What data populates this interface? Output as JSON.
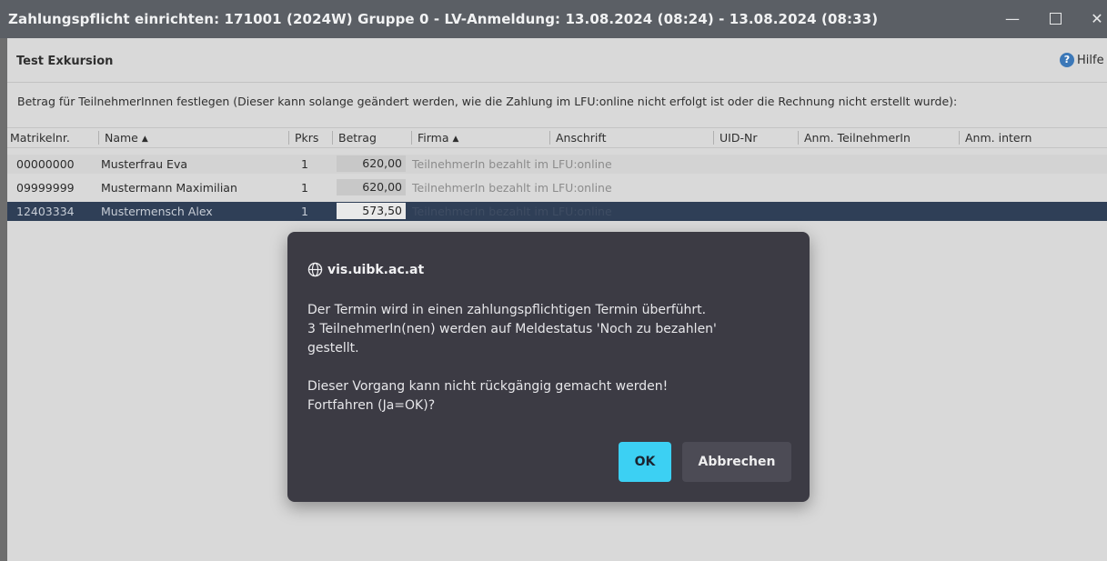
{
  "window": {
    "title": "Zahlungspflicht einrichten:  171001 (2024W)  Gruppe 0 - LV-Anmeldung: 13.08.2024 (08:24) - 13.08.2024 (08:33)",
    "minimize": "—",
    "close": "✕"
  },
  "header": {
    "name": "Test Exkursion",
    "help": "Hilfe",
    "help_icon": "?"
  },
  "instruction": "Betrag für TeilnehmerInnen festlegen (Dieser kann solange geändert werden, wie die Zahlung im LFU:online nicht erfolgt ist oder die Rechnung nicht erstellt wurde):",
  "table": {
    "columns": {
      "matrikel": "Matrikelnr.",
      "name": "Name",
      "pkrs": "Pkrs",
      "betrag": "Betrag",
      "firma": "Firma",
      "anschrift": "Anschrift",
      "uid": "UID-Nr",
      "anm_teilnehmer": "Anm. TeilnehmerIn",
      "anm_intern": "Anm. intern"
    },
    "sort_indicator": "▲",
    "rows": [
      {
        "matrikel": "00000000",
        "name": "Musterfrau Eva",
        "pkrs": "1",
        "betrag": "620,00",
        "firma": "TeilnehmerIn bezahlt im LFU:online"
      },
      {
        "matrikel": "09999999",
        "name": "Mustermann Maximilian",
        "pkrs": "1",
        "betrag": "620,00",
        "firma": "TeilnehmerIn bezahlt im LFU:online"
      },
      {
        "matrikel": "12403334",
        "name": "Mustermensch Alex",
        "pkrs": "1",
        "betrag": "573,50",
        "firma": "TeilnehmerIn bezahlt im LFU:online"
      }
    ]
  },
  "dialog": {
    "origin": "vis.uibk.ac.at",
    "line1": "Der Termin wird in einen zahlungspflichtigen Termin überführt.",
    "line2": "3 TeilnehmerIn(nen) werden auf Meldestatus 'Noch zu bezahlen'",
    "line3": "gestellt.",
    "line4": "Dieser Vorgang kann nicht rückgängig gemacht werden!",
    "line5": "Fortfahren (Ja=OK)?",
    "ok": "OK",
    "cancel": "Abbrechen"
  },
  "colors": {
    "accent_button": "#3cd0f3",
    "dialog_bg": "#3c3b44",
    "selected_row": "#2f3f57",
    "titlebar": "#5b5f65"
  }
}
